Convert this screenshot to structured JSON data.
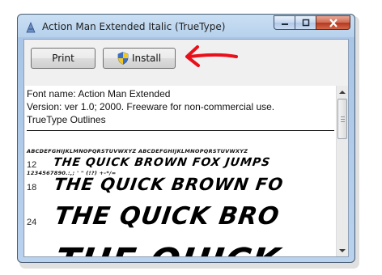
{
  "window": {
    "title": "Action Man Extended Italic (TrueType)"
  },
  "toolbar": {
    "print_label": "Print",
    "install_label": "Install"
  },
  "info": {
    "font_name": "Font name: Action Man Extended",
    "version": "Version: ver 1.0; 2000. Freeware for non-commercial use.",
    "outlines": "TrueType Outlines"
  },
  "charset": {
    "line1": "ABCDEFGHIJKLMNOPQRSTUVWXYZ ABCDEFGHIJKLMNOPQRSTUVWXYZ",
    "line2": "1234567890.:,; ' \" (!?) +-*/="
  },
  "samples": [
    {
      "size": "12",
      "text": "THE QUICK BROWN FOX JUMPS"
    },
    {
      "size": "18",
      "text": "THE QUICK BROWN FO"
    },
    {
      "size": "24",
      "text": "THE QUICK BRO"
    },
    {
      "size": "",
      "text": "THE QUICK"
    }
  ],
  "colors": {
    "annotation_arrow": "#e8101a",
    "close_button": "#c94a2f"
  },
  "icons": {
    "app": "font-file-icon",
    "install": "uac-shield-icon"
  }
}
